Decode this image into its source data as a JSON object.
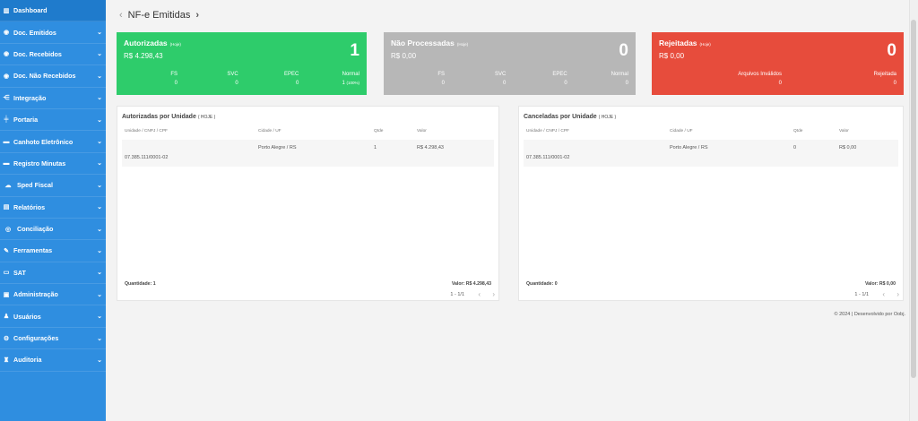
{
  "sidebar": {
    "items": [
      {
        "label": "Dashboard",
        "icon": "chart-icon",
        "glyph": "▥",
        "chevron": false
      },
      {
        "label": "Doc. Emitidos",
        "icon": "circle-icon",
        "glyph": "◉",
        "chevron": true
      },
      {
        "label": "Doc. Recebidos",
        "icon": "circle-icon",
        "glyph": "◉",
        "chevron": true
      },
      {
        "label": "Doc. Não Recebidos",
        "icon": "circle-icon",
        "glyph": "◉",
        "chevron": true
      },
      {
        "label": "Integração",
        "icon": "share-icon",
        "glyph": "⋲",
        "chevron": true
      },
      {
        "label": "Portaria",
        "icon": "gate-icon",
        "glyph": "╪",
        "chevron": true
      },
      {
        "label": "Canhoto Eletrônico",
        "icon": "truck-icon",
        "glyph": "▬",
        "chevron": true
      },
      {
        "label": "Registro Minutas",
        "icon": "truck-icon",
        "glyph": "▬",
        "chevron": true
      },
      {
        "label": "Sped Fiscal",
        "icon": "cloud-icon",
        "glyph": "☁",
        "chevron": true
      },
      {
        "label": "Relatórios",
        "icon": "list-icon",
        "glyph": "▤",
        "chevron": true
      },
      {
        "label": "Conciliação",
        "icon": "eye-icon",
        "glyph": "◎",
        "chevron": true
      },
      {
        "label": "Ferramentas",
        "icon": "wrench-icon",
        "glyph": "✎",
        "chevron": true
      },
      {
        "label": "SAT",
        "icon": "sat-icon",
        "glyph": "▭",
        "chevron": true
      },
      {
        "label": "Administração",
        "icon": "briefcase-icon",
        "glyph": "▣",
        "chevron": true
      },
      {
        "label": "Usuários",
        "icon": "users-icon",
        "glyph": "♟",
        "chevron": true
      },
      {
        "label": "Configurações",
        "icon": "gears-icon",
        "glyph": "⚙",
        "chevron": true
      },
      {
        "label": "Auditoria",
        "icon": "binoculars-icon",
        "glyph": "♜",
        "chevron": true
      }
    ],
    "chevron_glyph": "⌄"
  },
  "header": {
    "back_glyph": "‹",
    "title": "NF-e Emitidas",
    "forward_glyph": "›"
  },
  "cards": {
    "autorizadas": {
      "title": "Autorizadas",
      "tag": "(Hoje)",
      "amount": "R$ 4.298,43",
      "count": "1",
      "cols": [
        {
          "label": "FS",
          "value": "0",
          "suffix": ""
        },
        {
          "label": "SVC",
          "value": "0",
          "suffix": ""
        },
        {
          "label": "EPEC",
          "value": "0",
          "suffix": ""
        },
        {
          "label": "Normal",
          "value": "1",
          "suffix": "(100%)"
        }
      ]
    },
    "nao_processadas": {
      "title": "Não Processadas",
      "tag": "(Hoje)",
      "amount": "R$ 0,00",
      "count": "0",
      "cols": [
        {
          "label": "FS",
          "value": "0"
        },
        {
          "label": "SVC",
          "value": "0"
        },
        {
          "label": "EPEC",
          "value": "0"
        },
        {
          "label": "Normal",
          "value": "0"
        }
      ]
    },
    "rejeitadas": {
      "title": "Rejeitadas",
      "tag": "(Hoje)",
      "amount": "R$ 0,00",
      "count": "0",
      "cols": [
        {
          "label": "Arquivos Inválidos",
          "value": "0"
        },
        {
          "label": "Rejeitada",
          "value": "0"
        }
      ]
    }
  },
  "panels": {
    "autorizadas": {
      "title": "Autorizadas por Unidade",
      "tag": "( HOJE )",
      "headers": [
        "Unidade / CNPJ / CPF",
        "Cidade / UF",
        "Qtde",
        "Valor"
      ],
      "row": {
        "unidade": "07.385.111/0001-02",
        "cidade": "Porto Alegre / RS",
        "qtde": "1",
        "valor": "R$ 4.298,43"
      },
      "quantidade": "Quantidade: 1",
      "valor_total": "Valor: R$ 4.298,43",
      "pagination": "1 - 1/1"
    },
    "canceladas": {
      "title": "Canceladas por Unidade",
      "tag": "( HOJE )",
      "headers": [
        "Unidade / CNPJ / CPF",
        "Cidade / UF",
        "Qtde",
        "Valor"
      ],
      "row": {
        "unidade": "07.385.111/0001-02",
        "cidade": "Porto Alegre / RS",
        "qtde": "0",
        "valor": "R$ 0,00"
      },
      "quantidade": "Quantidade: 0",
      "valor_total": "Valor: R$ 0,00",
      "pagination": "1 - 1/1"
    },
    "prev_glyph": "‹",
    "next_glyph": "›"
  },
  "footer": {
    "text": "© 2024 | Desenvolvido por Oobj."
  },
  "colors": {
    "sidebar": "#2f8ee0",
    "green": "#2ecc6b",
    "grey": "#b7b7b7",
    "red": "#e74c3c"
  }
}
